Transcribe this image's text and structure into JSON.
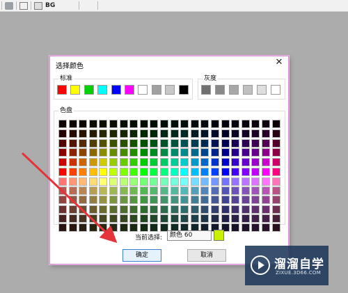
{
  "toolbar": {
    "bg_label": "BG"
  },
  "dialog": {
    "title": "选择颜色",
    "close_glyph": "✕",
    "standard_label": "标准",
    "gray_label": "灰度",
    "palette_label": "色盘",
    "current_label": "当前选择:",
    "current_value": "颜色 60",
    "current_color": "#c8f000",
    "ok_label": "确定",
    "cancel_label": "取消"
  },
  "standard_colors": [
    "#ff0000",
    "#ffff00",
    "#00d000",
    "#00ffff",
    "#0000ff",
    "#ff00ff",
    "#ffffff",
    "#a0a0a0",
    "#c8c8c8",
    "#000000"
  ],
  "gray_colors": [
    "#707070",
    "#8a8a8a",
    "#a8a8a8",
    "#c0c0c0",
    "#dedede",
    "#ffffff"
  ],
  "palette": {
    "columns": [
      "#ff0000",
      "#ff4000",
      "#ff8000",
      "#ffbf00",
      "#ffff00",
      "#bfff00",
      "#80ff00",
      "#40ff00",
      "#00ff00",
      "#00ff40",
      "#00ff80",
      "#00ffbf",
      "#00ffff",
      "#00bfff",
      "#0080ff",
      "#0040ff",
      "#0000ff",
      "#4000ff",
      "#8000ff",
      "#bf00ff",
      "#ff00ff",
      "#ff0080"
    ],
    "top_levels": [
      0.05,
      0.15,
      0.32,
      0.55,
      0.8,
      1.0
    ],
    "bottom_levels": [
      0.45,
      0.72,
      0.58,
      0.42,
      0.28,
      0.16
    ]
  },
  "watermark": {
    "title": "溜溜自学",
    "subtitle": "ZIXUE.3D66.COM"
  }
}
